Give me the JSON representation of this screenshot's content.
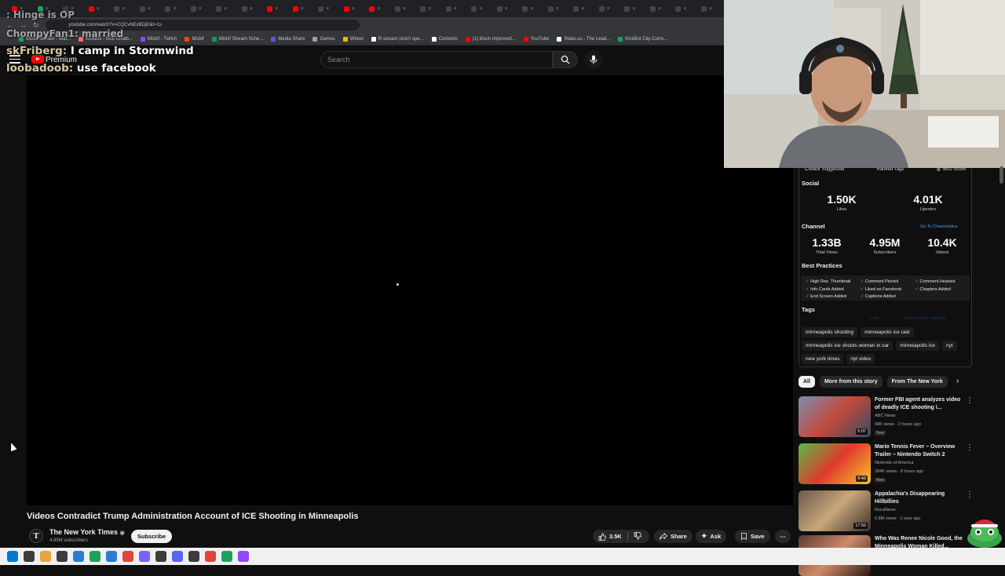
{
  "browser": {
    "tab_icon_colors": [
      "#ff0000",
      "#1da15c",
      "#3c3c3c",
      "#ff0000",
      "#444",
      "#444",
      "#444",
      "#444",
      "#444",
      "#444",
      "#ff0000",
      "#ff0000",
      "#444",
      "#ff0000",
      "#ff0000",
      "#444",
      "#444",
      "#444",
      "#444",
      "#444",
      "#444",
      "#444",
      "#444",
      "#444",
      "#444",
      "#444",
      "#444",
      "#444"
    ],
    "url": "youtube.com/watch?v=CQCvNExBDjE&t=1s",
    "bookmarks": [
      {
        "label": "Mizkif Stream - Wat...",
        "color": "#1da15c"
      },
      {
        "label": "KickBot - Kick Chatb...",
        "color": "#ff6b6b"
      },
      {
        "label": "Mizkif - Twitch",
        "color": "#9146ff"
      },
      {
        "label": "Mizkif",
        "color": "#ff4500"
      },
      {
        "label": "Mizkif Stream Sche...",
        "color": "#0f9d58"
      },
      {
        "label": "Media Share",
        "color": "#5b5bd6"
      },
      {
        "label": "Games",
        "color": "#9aa0a6"
      },
      {
        "label": "Wheel",
        "color": "#f4b400"
      },
      {
        "label": "R-stream (don't ope...",
        "color": "#ffffff"
      },
      {
        "label": "Contexto",
        "color": "#ffffff"
      },
      {
        "label": "(1) Much improved...",
        "color": "#ff0000"
      },
      {
        "label": "YouTube",
        "color": "#ff0000"
      },
      {
        "label": "Stake.us - The Lead...",
        "color": "#ffffff"
      },
      {
        "label": "KickBot Clip Corre...",
        "color": "#1da15c"
      }
    ]
  },
  "header": {
    "premium_label": "Premium",
    "search_placeholder": "Search"
  },
  "chat": {
    "faded_line_1": ": Hinge is OP",
    "faded_line_2": "ChompyFan1: married",
    "line_1_user": "skFriberg:",
    "line_1_text": " I camp in Stormwind",
    "line_2_user": "loobadoob:",
    "line_2_text": " use facebook"
  },
  "video": {
    "title": "Videos Contradict Trump Administration Account of ICE Shooting in Minneapolis",
    "channel_initial": "T",
    "channel": "The New York Times",
    "subscribers": "4.95M subscribers",
    "subscribe_label": "Subscribe",
    "likes": "3.5K",
    "share_label": "Share",
    "ask_label": "Ask",
    "save_label": "Save"
  },
  "panel": {
    "tabs": [
      "Creator Suggested",
      "Ranked Tags",
      "SEO Score"
    ],
    "social_heading": "Social",
    "likes_value": "1.50K",
    "likes_label": "Likes",
    "upvotes_value": "4.01K",
    "upvotes_label": "Upvotes",
    "channel_heading": "Channel",
    "channel_link": "Go To Channelytics",
    "total_views_value": "1.33B",
    "total_views_label": "Total Views",
    "subscribers_value": "4.95M",
    "subscribers_label": "Subscribers",
    "videos_value": "10.4K",
    "videos_label": "Videos",
    "best_practices_heading": "Best Practices",
    "best_practices": [
      "High Res. Thumbnail",
      "Comment Pinned",
      "Comment Hearted",
      "Info Cards Added",
      "Liked on Facebook",
      "Chapters Added",
      "End Screen Added",
      "Captions Added"
    ],
    "tags_heading": "Tags",
    "tags_copy": "copy",
    "tags_show_rankings": "Show search rankings",
    "tags": [
      "minneapolis shooting",
      "minneapolis ice raid",
      "minneapolis ice shoots woman in car",
      "minneapolis ice",
      "nyt",
      "new york times",
      "nyt video"
    ]
  },
  "chips": [
    "All",
    "More from this story",
    "From The New York"
  ],
  "recommendations": [
    {
      "title": "Former FBI agent analyzes video of deadly ICE shooting i...",
      "channel": "ABC News",
      "meta": "68K views · 2 hours ago",
      "badge": "New",
      "duration": "5:07",
      "colors": [
        "#7a8db0",
        "#c24a3a",
        "#3a4a68"
      ]
    },
    {
      "title": "Mario Tennis Fever – Overview Trailer – Nintendo Switch 2",
      "channel": "Nintendo of America",
      "meta": "284K views · 8 hours ago",
      "badge": "New",
      "duration": "8:43",
      "colors": [
        "#58b84a",
        "#e13a2b",
        "#f6c431"
      ]
    },
    {
      "title": "Appalachia's Disappearing Hillbillies",
      "channel": "RocaNews",
      "meta": "6.8M views · 1 year ago",
      "badge": "",
      "duration": "17:55",
      "colors": [
        "#6b5a4a",
        "#c9a77b",
        "#3a2e25"
      ]
    },
    {
      "title": "Who Was Renee Nicole Good, the Minneapolis Woman Killed...",
      "channel": "",
      "meta": "",
      "badge": "",
      "duration": "",
      "colors": [
        "#5a3a30",
        "#d08a6a",
        "#2a1a15"
      ]
    }
  ]
}
